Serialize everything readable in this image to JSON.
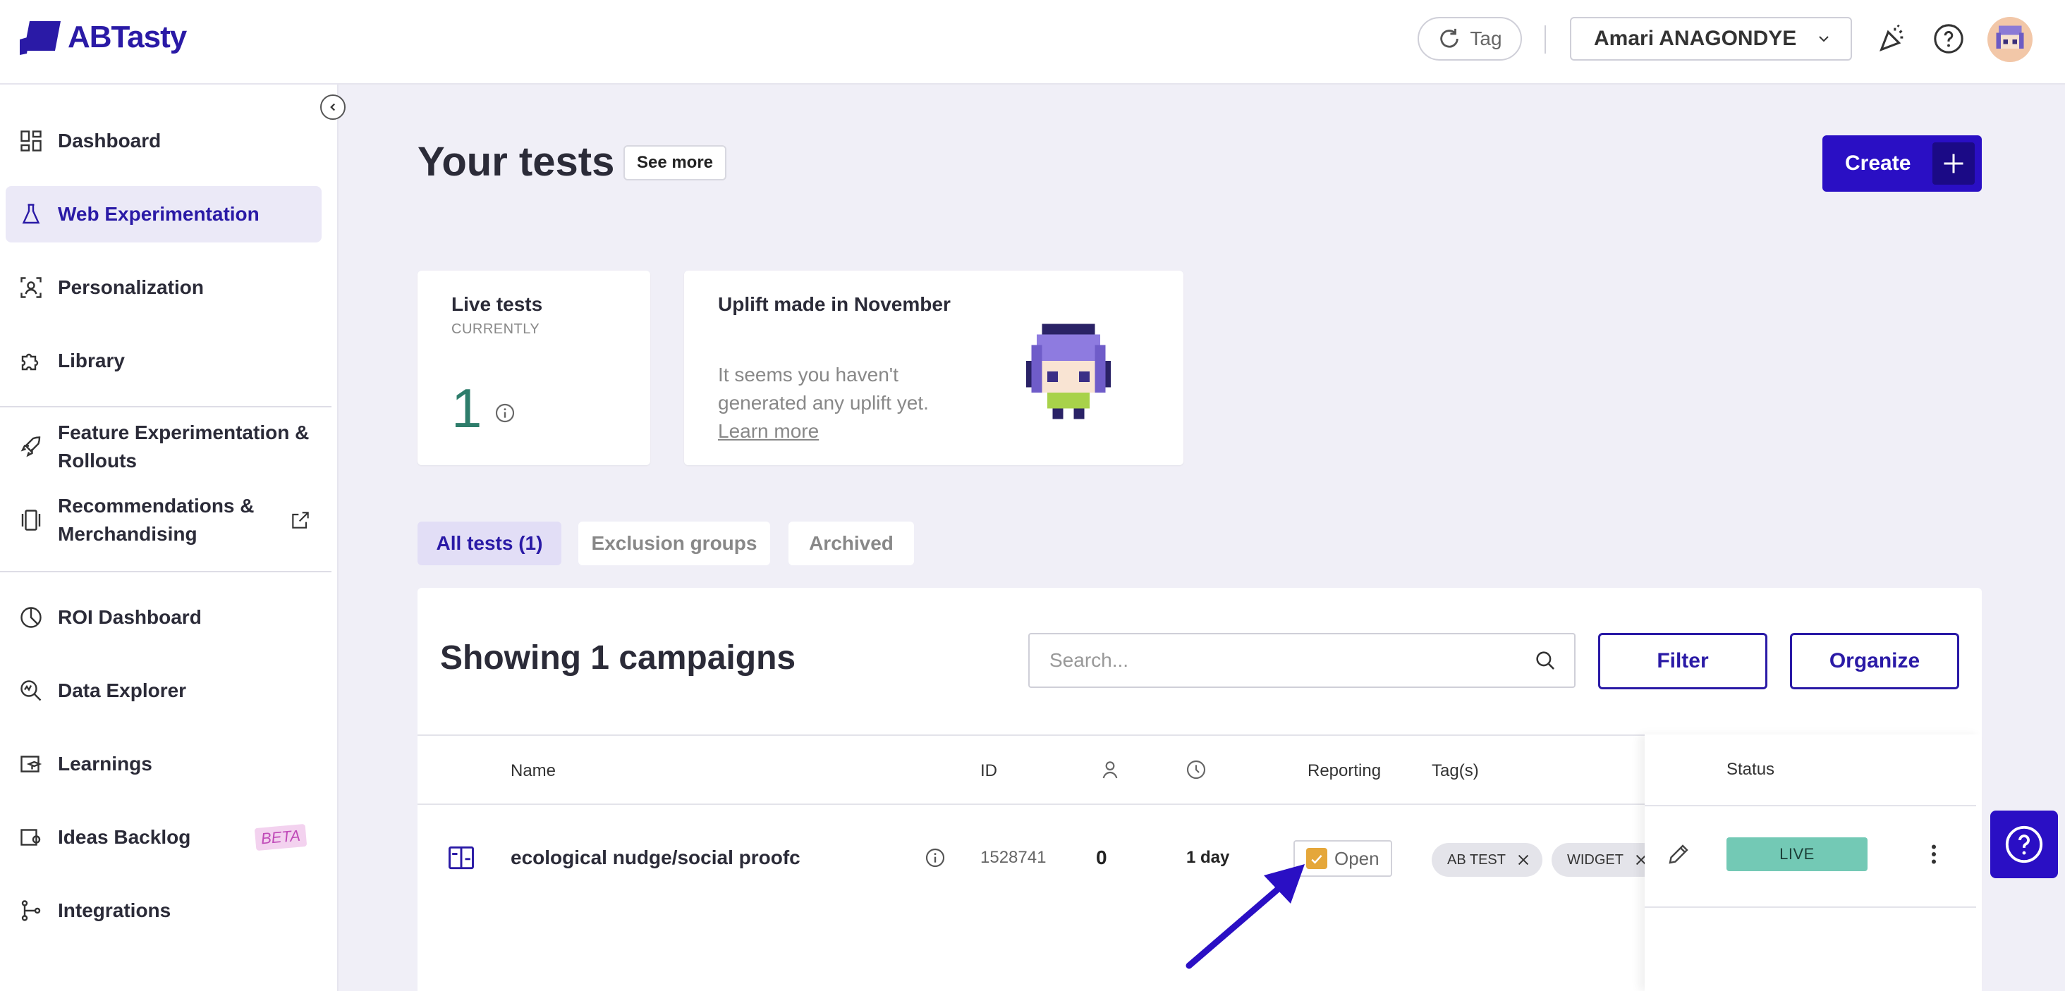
{
  "header": {
    "brand": "ABTasty",
    "tag_button": "Tag",
    "account": "Amari ANAGONDYE"
  },
  "sidebar": {
    "items": [
      {
        "label": "Dashboard"
      },
      {
        "label": "Web Experimentation"
      },
      {
        "label": "Personalization"
      },
      {
        "label": "Library"
      },
      {
        "label": "Feature Experimentation & Rollouts"
      },
      {
        "label": "Recommendations & Merchandising"
      },
      {
        "label": "ROI Dashboard"
      },
      {
        "label": "Data Explorer"
      },
      {
        "label": "Learnings"
      },
      {
        "label": "Ideas Backlog",
        "badge": "BETA"
      },
      {
        "label": "Integrations"
      }
    ]
  },
  "main": {
    "title": "Your tests",
    "see_more": "See more",
    "create": "Create",
    "live_card": {
      "title": "Live tests",
      "subtitle": "CURRENTLY",
      "count": "1"
    },
    "uplift_card": {
      "title": "Uplift made in November",
      "text": "It seems you haven't generated any uplift yet.",
      "link": "Learn more"
    },
    "tabs": [
      "All tests (1)",
      "Exclusion groups",
      "Archived"
    ],
    "showing": "Showing 1 campaigns",
    "search_placeholder": "Search...",
    "filter": "Filter",
    "organize": "Organize",
    "columns": {
      "name": "Name",
      "id": "ID",
      "reporting": "Reporting",
      "tags": "Tag(s)",
      "status": "Status"
    },
    "rows": [
      {
        "name": "ecological nudge/social proofc",
        "id": "1528741",
        "visitors": "0",
        "duration": "1 day",
        "reporting": "Open",
        "tags": [
          "AB TEST",
          "WIDGET"
        ],
        "status": "LIVE"
      }
    ]
  },
  "colors": {
    "brand": "#2a0fc4",
    "live": "#73c9b5",
    "live_count": "#2e7d6b"
  }
}
